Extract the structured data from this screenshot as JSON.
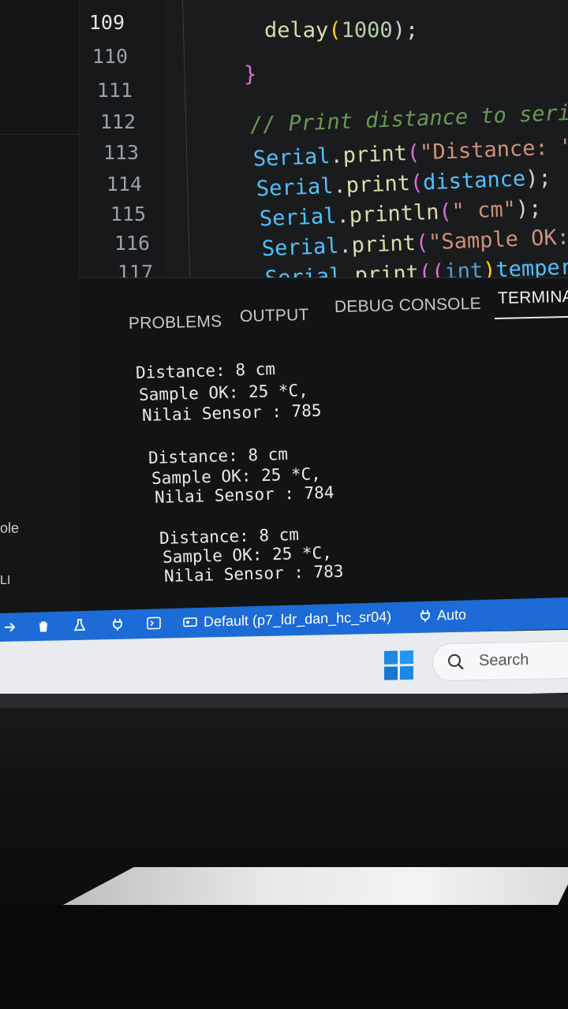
{
  "sidebar": {
    "fragments": [
      {
        "text": "ole"
      },
      {
        "text": "LI"
      }
    ]
  },
  "editor": {
    "line_numbers": [
      "109",
      "110",
      "111",
      "112",
      "113",
      "114",
      "115",
      "116",
      "117"
    ],
    "code": {
      "l109": {
        "fn": "delay",
        "open": "(",
        "num": "1000",
        "close": ");"
      },
      "l110": {
        "brace": "}"
      },
      "l112": {
        "comment": "// Print distance to serial mo"
      },
      "l113": {
        "obj": "Serial",
        "dot": ".",
        "fn": "print",
        "open": "(",
        "str": "\"Distance: \"",
        "close": ");"
      },
      "l114": {
        "obj": "Serial",
        "dot": ".",
        "fn": "print",
        "open": "(",
        "arg": "distance",
        "close": ");"
      },
      "l115": {
        "obj": "Serial",
        "dot": ".",
        "fn": "println",
        "open": "(",
        "str": "\" cm\"",
        "close": ");"
      },
      "l116": {
        "obj": "Serial",
        "dot": ".",
        "fn": "print",
        "open": "(",
        "str": "\"Sample OK: \"",
        "close": ");"
      },
      "l117": {
        "obj": "Serial",
        "dot": ".",
        "fn": "print",
        "open": "((",
        "kw": "int",
        "mid": ")",
        "arg": "temperature",
        "close": ");"
      }
    }
  },
  "panel": {
    "tabs": [
      "PROBLEMS",
      "OUTPUT",
      "DEBUG CONSOLE",
      "TERMINA"
    ],
    "active_tab": "TERMINA",
    "terminal_output": [
      "Distance: 8 cm",
      "Sample OK: 25 *C,",
      "Nilai Sensor : 785",
      "Distance: 8 cm",
      "Sample OK: 25 *C,",
      "Nilai Sensor : 784",
      "Distance: 8 cm",
      "Sample OK: 25 *C,",
      "Nilai Sensor : 783"
    ]
  },
  "statusbar": {
    "environment": "Default (p7_ldr_dan_hc_sr04)",
    "port_mode": "Auto",
    "icons": [
      "arrow-right-icon",
      "trash-icon",
      "flask-icon",
      "plug-icon",
      "terminal-icon",
      "device-icon",
      "plug-icon"
    ]
  },
  "taskbar": {
    "search_label": "Search"
  },
  "colors": {
    "statusbar": "#1c6bd6",
    "editor_bg": "#1a1b1d",
    "terminal_bg": "#121314",
    "taskbar": "#e9ebee"
  }
}
